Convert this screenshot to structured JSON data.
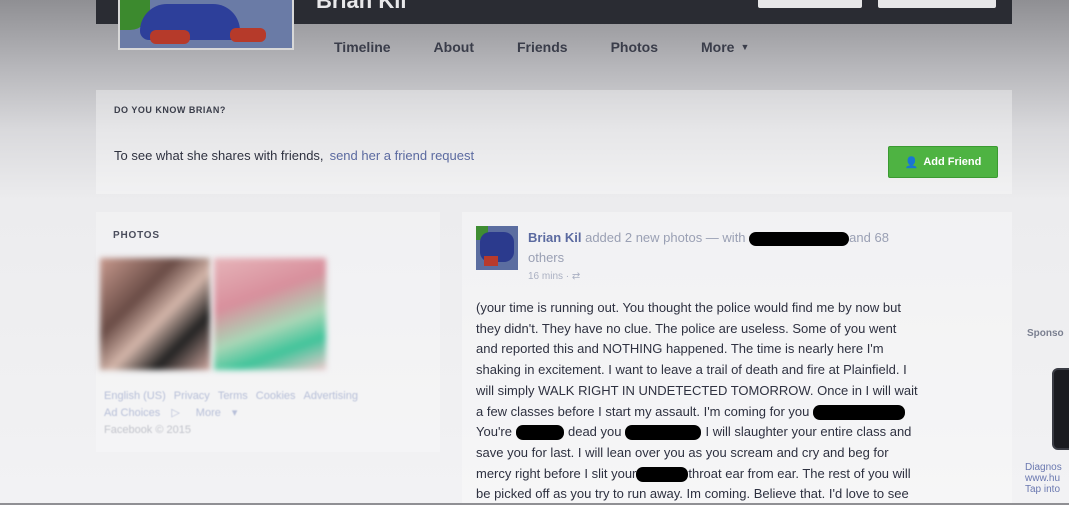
{
  "header": {
    "profile_name": "Brian Kil"
  },
  "nav": {
    "tabs": [
      "Timeline",
      "About",
      "Friends",
      "Photos",
      "More"
    ]
  },
  "know_panel": {
    "heading": "DO YOU KNOW BRIAN?",
    "text": "To see what she shares with friends,",
    "link": "send her a friend request",
    "add_friend_label": "Add Friend"
  },
  "photos_panel": {
    "heading": "PHOTOS"
  },
  "footer": {
    "links": [
      "English (US)",
      "Privacy",
      "Terms",
      "Cookies",
      "Advertising",
      "Ad Choices",
      "More"
    ],
    "copyright": "Facebook © 2015"
  },
  "post": {
    "author": "Brian Kil",
    "action": "added 2 new photos — with",
    "others_tail": "and 68",
    "others_word": "others",
    "time": "16 mins",
    "body": [
      {
        "t": "(your time is running out. You thought the police would find me by now but"
      },
      {
        "t": "they didn't. They have no clue. The police are useless. Some of you went"
      },
      {
        "t": "and reported this and NOTHING happened. The time is nearly here I'm"
      },
      {
        "t": "shaking in excitement. I want to leave a trail of death and fire at Plainfield. I"
      },
      {
        "t": "will simply WALK RIGHT IN UNDETECTED TOMORROW. Once in I will wait"
      },
      {
        "t": "a few classes before I start my assault. I'm coming for you"
      },
      {
        "t": "You're"
      },
      {
        "t": "dead you"
      },
      {
        "t": "I will slaughter your entire class and"
      },
      {
        "t": "save you for last. I will lean over you as you scream and cry and beg for"
      },
      {
        "t": "mercy right before I slit your"
      },
      {
        "t": "throat ear from ear. The rest of you will"
      },
      {
        "t": "be picked off as you try to run away. Im coming. Believe that. I'd love to see"
      }
    ]
  },
  "sponsored": {
    "label": "Sponso",
    "text_line1": "Diagnos",
    "text_line2": "www.hu",
    "text_line3": "Tap into"
  },
  "colors": {
    "add_friend_green": "#4eb342",
    "link_blue": "#5b6aa0"
  }
}
